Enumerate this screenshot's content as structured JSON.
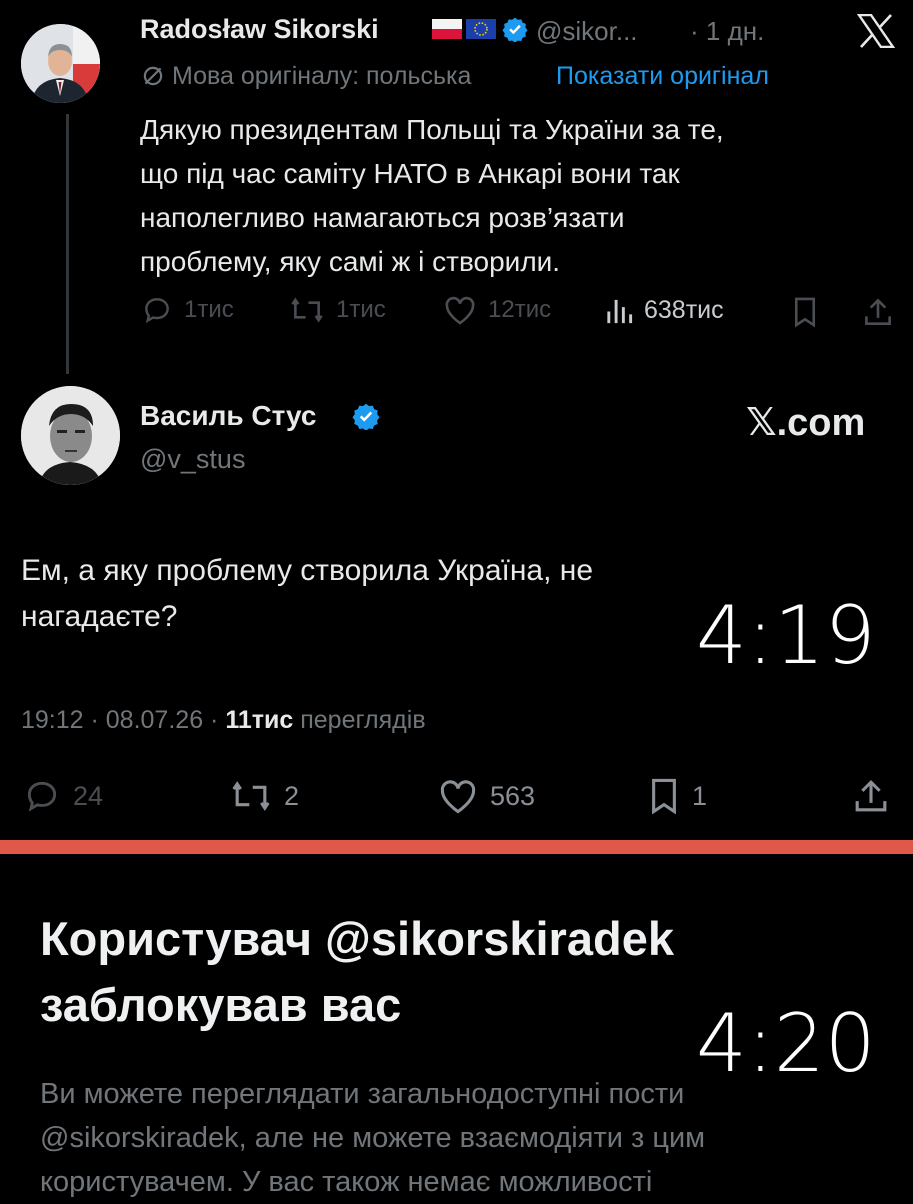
{
  "quoted_tweet": {
    "author_name": "Radosław Sikorski",
    "handle": "@sikor...",
    "age": "· 1 дн.",
    "lang_note": "Мова оригіналу: польська",
    "show_original": "Показати оригінал",
    "text_lines": [
      "Дякую президентам Польщі та України за те,",
      "що під час саміту НАТО в Анкарі вони так",
      "наполегливо намагаються розв’язати",
      "проблему, яку самі ж і створили."
    ],
    "stats": {
      "replies": "1тис",
      "reposts": "1тис",
      "likes": "12тис",
      "views": "638тис"
    }
  },
  "main_tweet": {
    "author_name": "Василь Стус",
    "handle": "@v_stus",
    "xcom_label": "𝕏.com",
    "text_lines": [
      "Ем, а яку проблему створила Україна, не",
      "нагадаєте?"
    ],
    "timestamp": "19:12 · 08.07.26 ·",
    "views_count": "11тис",
    "views_label": "переглядів",
    "stats": {
      "replies": "24",
      "reposts": "2",
      "likes": "563",
      "bookmarks": "1"
    }
  },
  "overlay_times": [
    "4:19",
    "4:20"
  ],
  "blocked": {
    "title_line1": "Користувач @sikorskiradek",
    "title_line2": "заблокував вас",
    "body_lines": [
      "Ви можете переглядати загальнодоступні пости",
      "@sikorskiradek, але не можете взаємодіяти з цим",
      "користувачем. У вас також немає можливості"
    ]
  },
  "colors": {
    "accent": "#1d9bf0",
    "divider": "#e0584a",
    "background": "#000000"
  },
  "icons": [
    "x-logo-icon",
    "globe-slash-icon",
    "verified-icon",
    "reply-icon",
    "repost-icon",
    "like-icon",
    "views-icon",
    "bookmark-icon",
    "share-icon"
  ]
}
